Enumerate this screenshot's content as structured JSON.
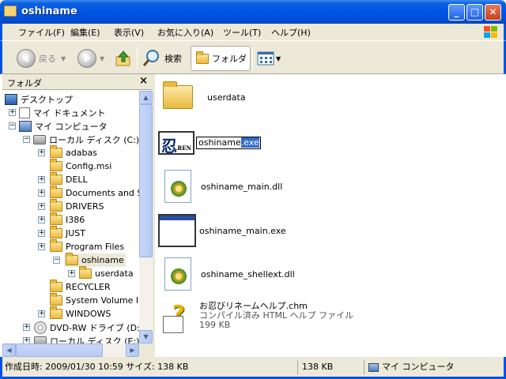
{
  "window": {
    "title": "oshiname",
    "buttons": {
      "minimize": "_",
      "maximize": "□",
      "close": "✕"
    }
  },
  "menu": [
    "ファイル(F)",
    "編集(E)",
    "表示(V)",
    "お気に入り(A)",
    "ツール(T)",
    "ヘルプ(H)"
  ],
  "toolbar": {
    "back": "戻る",
    "search": "検索",
    "folders": "フォルダ"
  },
  "folder_panel": {
    "title": "フォルダ",
    "close": "×"
  },
  "tree": [
    {
      "label": "デスクトップ"
    },
    {
      "label": "マイ ドキュメント",
      "expander": "+"
    },
    {
      "label": "マイ コンピュータ",
      "expander": "−"
    },
    {
      "label": "ローカル ディスク (C:)",
      "expander": "−"
    },
    {
      "label": "adabas",
      "expander": "+"
    },
    {
      "label": "Config.msi"
    },
    {
      "label": "DELL",
      "expander": "+"
    },
    {
      "label": "Documents and S",
      "expander": "+"
    },
    {
      "label": "DRIVERS",
      "expander": "+"
    },
    {
      "label": "I386",
      "expander": "+"
    },
    {
      "label": "JUST",
      "expander": "+"
    },
    {
      "label": "Program Files",
      "expander": "+"
    },
    {
      "label": "oshiname",
      "expander": "−"
    },
    {
      "label": "userdata",
      "expander": "+"
    },
    {
      "label": "RECYCLER"
    },
    {
      "label": "System Volume I"
    },
    {
      "label": "WINDOWS",
      "expander": "+"
    },
    {
      "label": "DVD-RW ドライブ (D:)",
      "expander": "+"
    },
    {
      "label": "ローカル ディスク (E:)",
      "expander": "+"
    }
  ],
  "content": {
    "items": [
      {
        "name": "userdata"
      },
      {
        "name_plain": "oshiname",
        "name_selected": ".exe",
        "icon_kanji": "忍",
        "icon_tag": ".REN"
      },
      {
        "name": "oshiname_main.dll"
      },
      {
        "name": "oshiname_main.exe"
      },
      {
        "name": "oshiname_shellext.dll"
      },
      {
        "name": "お忍びリネームヘルプ.chm",
        "type": "コンパイル済み HTML ヘルプ ファイル",
        "size": "199 KB"
      }
    ]
  },
  "status": {
    "info": "作成日時: 2009/01/30 10:59 サイズ: 138 KB",
    "size": "138 KB",
    "location": "マイ コンピュータ"
  }
}
